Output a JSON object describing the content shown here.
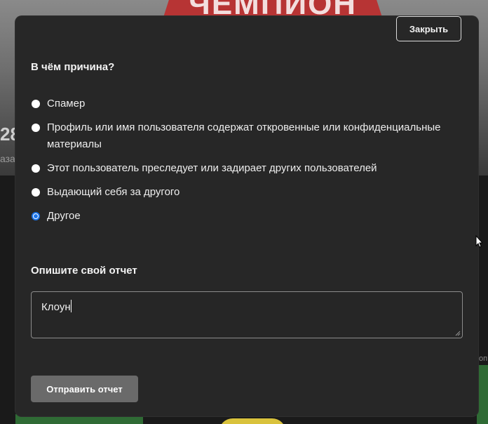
{
  "background": {
    "banner_text": "ЧЕМПИОН",
    "left_number": "28",
    "left_small_text": "азад",
    "right_small_text": "оп"
  },
  "modal": {
    "close_label": "Закрыть",
    "reason_title": "В чём причина?",
    "reasons": [
      {
        "label": "Спамер",
        "checked": false
      },
      {
        "label": "Профиль или имя пользователя содержат откровенные или конфиденциальные материалы",
        "checked": false
      },
      {
        "label": "Этот пользователь преследует или задирает других пользователей",
        "checked": false
      },
      {
        "label": "Выдающий себя за другого",
        "checked": false
      },
      {
        "label": "Другое",
        "checked": true
      }
    ],
    "describe_title": "Опишите свой отчет",
    "report_text": "Клоун",
    "submit_label": "Отправить отчет"
  },
  "colors": {
    "modal_bg": "#272727",
    "radio_accent": "#1a73e8",
    "submit_bg": "#6a6a6a"
  }
}
